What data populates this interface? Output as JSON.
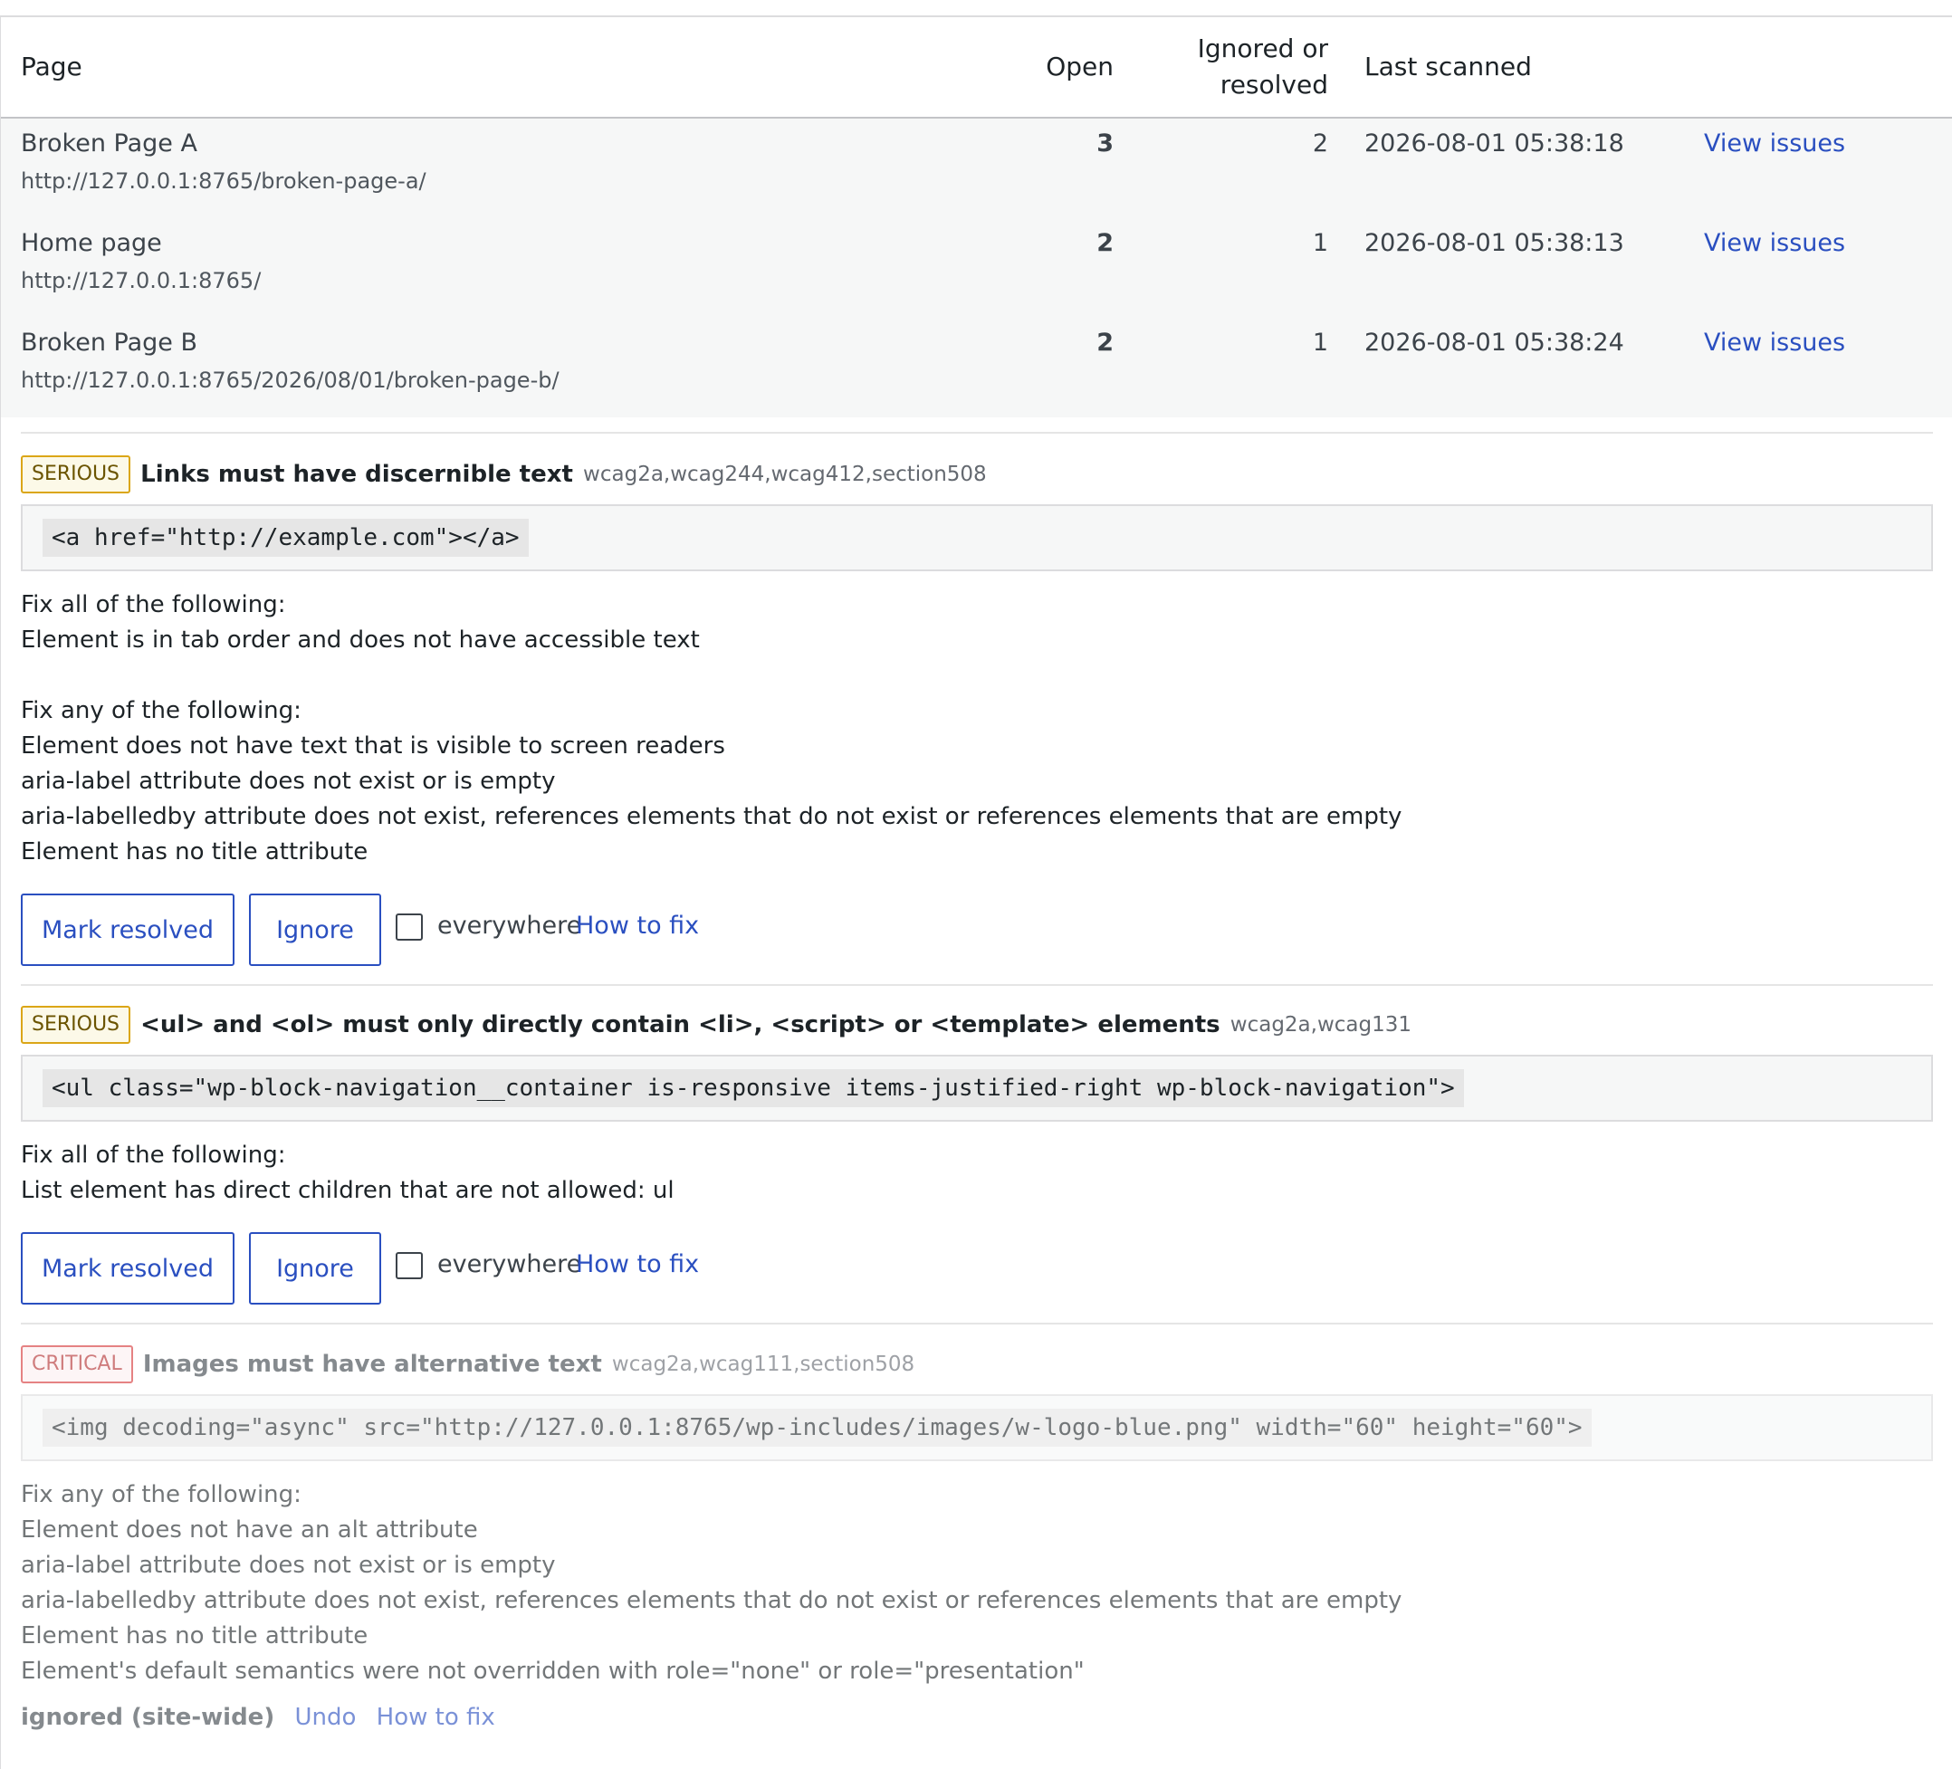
{
  "table": {
    "headers": {
      "page": "Page",
      "open": "Open",
      "ignored_line1": "Ignored or",
      "ignored_line2": "resolved",
      "last_scanned": "Last scanned"
    },
    "rows": [
      {
        "title": "Broken Page A",
        "url": "http://127.0.0.1:8765/broken-page-a/",
        "open": "3",
        "ignored": "2",
        "last_scanned": "2026-08-01 05:38:18",
        "action": "View issues"
      },
      {
        "title": "Home page",
        "url": "http://127.0.0.1:8765/",
        "open": "2",
        "ignored": "1",
        "last_scanned": "2026-08-01 05:38:13",
        "action": "View issues"
      },
      {
        "title": "Broken Page B",
        "url": "http://127.0.0.1:8765/2026/08/01/broken-page-b/",
        "open": "2",
        "ignored": "1",
        "last_scanned": "2026-08-01 05:38:24",
        "action": "View issues"
      }
    ]
  },
  "issues": [
    {
      "severity": "SERIOUS",
      "title": "Links must have discernible text",
      "tags": "wcag2a,wcag244,wcag412,section508",
      "code": "<a href=\"http://example.com\"></a>",
      "fix_all_heading": "Fix all of the following:",
      "fix_all": [
        "Element is in tab order and does not have accessible text"
      ],
      "fix_any_heading": "Fix any of the following:",
      "fix_any": [
        "Element does not have text that is visible to screen readers",
        "aria-label attribute does not exist or is empty",
        "aria-labelledby attribute does not exist, references elements that do not exist or references elements that are empty",
        "Element has no title attribute"
      ],
      "mark_resolved": "Mark resolved",
      "ignore": "Ignore",
      "everywhere": "everywhere",
      "how_to_fix": "How to fix"
    },
    {
      "severity": "SERIOUS",
      "title": "<ul> and <ol> must only directly contain <li>, <script> or <template> elements",
      "tags": "wcag2a,wcag131",
      "code": "<ul class=\"wp-block-navigation__container is-responsive items-justified-right wp-block-navigation\">",
      "fix_all_heading": "Fix all of the following:",
      "fix_all": [
        "List element has direct children that are not allowed: ul"
      ],
      "mark_resolved": "Mark resolved",
      "ignore": "Ignore",
      "everywhere": "everywhere",
      "how_to_fix": "How to fix"
    },
    {
      "severity": "CRITICAL",
      "title": "Images must have alternative text",
      "tags": "wcag2a,wcag111,section508",
      "code": "<img decoding=\"async\" src=\"http://127.0.0.1:8765/wp-includes/images/w-logo-blue.png\" width=\"60\" height=\"60\">",
      "fix_any_heading": "Fix any of the following:",
      "fix_any": [
        "Element does not have an alt attribute",
        "aria-label attribute does not exist or is empty",
        "aria-labelledby attribute does not exist, references elements that do not exist or references elements that are empty",
        "Element has no title attribute",
        "Element's default semantics were not overridden with role=\"none\" or role=\"presentation\""
      ],
      "status": "ignored (site-wide)",
      "undo": "Undo",
      "how_to_fix": "How to fix"
    }
  ],
  "colors": {
    "link": "#2a4fc0",
    "serious_border": "#dba617",
    "critical_border": "#d63638",
    "row_bg": "#f6f7f7"
  }
}
